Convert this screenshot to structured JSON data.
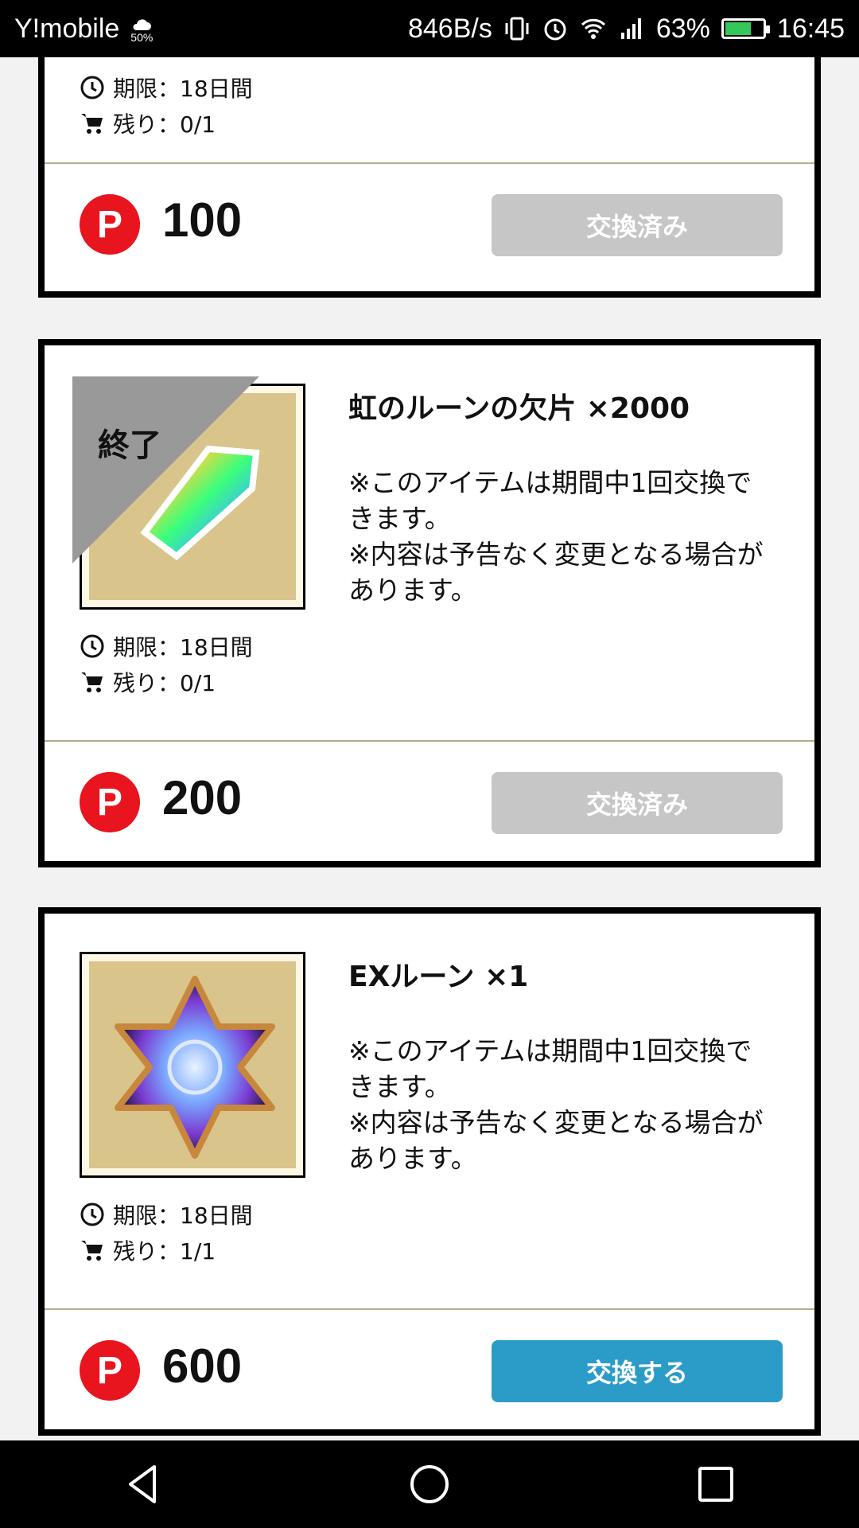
{
  "status_bar": {
    "carrier": "Y!mobile",
    "battery_saver": "50%",
    "speed": "846B/s",
    "battery_percent": "63%",
    "time": "16:45"
  },
  "partial_card": {
    "period": "期限：18日間",
    "remaining": "残り：0/1",
    "price": "100",
    "button": "交換済み"
  },
  "cards": [
    {
      "ended_label": "終了",
      "title": "虹のルーンの欠片 ×2000",
      "desc_line1": "※このアイテムは期間中1回交換できます。",
      "desc_line2": "※内容は予告なく変更となる場合があります。",
      "period": "期限：18日間",
      "remaining": "残り：0/1",
      "price": "200",
      "button": "交換済み"
    },
    {
      "title": "EXルーン ×1",
      "desc_line1": "※このアイテムは期間中1回交換できます。",
      "desc_line2": "※内容は予告なく変更となる場合があります。",
      "period": "期限：18日間",
      "remaining": "残り：1/1",
      "price": "600",
      "button": "交換する"
    }
  ],
  "point_badge": "P",
  "colors": {
    "point_badge": "#e8141e",
    "button_active": "#2b9bc8",
    "button_done": "#c6c6c6"
  }
}
